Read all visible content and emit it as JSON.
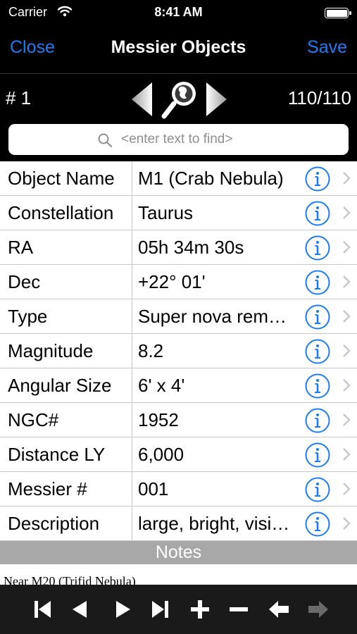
{
  "status_bar": {
    "carrier": "Carrier",
    "time": "8:41 AM"
  },
  "nav": {
    "close_label": "Close",
    "title": "Messier Objects",
    "save_label": "Save"
  },
  "toolbar": {
    "index_label": "# 1",
    "count_label": "110/110"
  },
  "search": {
    "placeholder": "<enter text to find>",
    "value": ""
  },
  "rows": [
    {
      "label": "Object Name",
      "value": "M1 (Crab Nebula)"
    },
    {
      "label": "Constellation",
      "value": "Taurus"
    },
    {
      "label": "RA",
      "value": "05h 34m 30s"
    },
    {
      "label": "Dec",
      "value": "+22° 01'"
    },
    {
      "label": "Type",
      "value": "Super nova rem…"
    },
    {
      "label": "Magnitude",
      "value": "8.2"
    },
    {
      "label": "Angular Size",
      "value": "6' x 4'"
    },
    {
      "label": "NGC#",
      "value": "1952"
    },
    {
      "label": "Distance LY",
      "value": "6,000"
    },
    {
      "label": "Messier #",
      "value": "001"
    },
    {
      "label": "Description",
      "value": "large, bright, visi…"
    }
  ],
  "notes": {
    "header": "Notes",
    "text": "Near M20 (Trifid Nebula)"
  },
  "bottom_toolbar": {
    "icons": [
      "skip-first-icon",
      "previous-icon",
      "play-icon",
      "skip-last-icon",
      "plus-icon",
      "minus-icon",
      "back-arrow-icon",
      "forward-arrow-icon"
    ]
  },
  "colors": {
    "accent": "#1e7cf2",
    "bar_background": "#000000",
    "notes_header": "#a8a8a8",
    "separator": "#c8c7cc"
  }
}
